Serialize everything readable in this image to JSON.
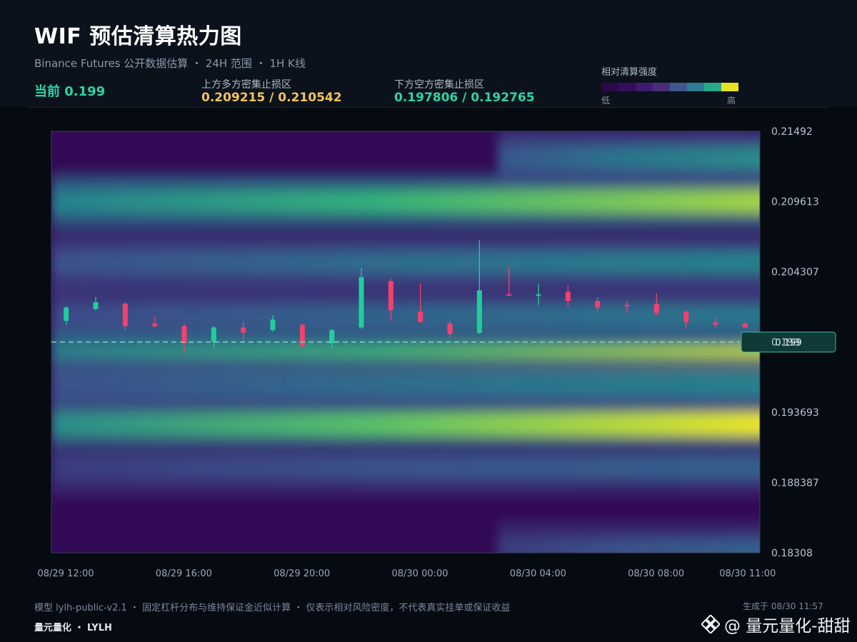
{
  "header": {
    "title": "WIF 预估清算热力图",
    "subtitle": "Binance Futures 公开数据估算 ・ 24H 范围 ・ 1H K线",
    "current_label": "当前 0.199",
    "upper_zone_label": "上方多方密集止损区",
    "upper_zone_value": "0.209215 / 0.210542",
    "lower_zone_label": "下方空方密集止损区",
    "lower_zone_value": "0.197806 / 0.192765"
  },
  "legend": {
    "title": "相对清算强度",
    "low": "低",
    "high": "高",
    "colors": [
      "#2b0a4c",
      "#360d5e",
      "#3f1b6f",
      "#4a2c7c",
      "#41568f",
      "#2f7a94",
      "#27a98a",
      "#e9e221"
    ]
  },
  "colors": {
    "up_candle": "#1fcf9b",
    "down_candle": "#f2416e",
    "current_line": "#7fd7d0",
    "accent_green": "#2fd4a6",
    "accent_gold": "#f5c35c"
  },
  "chart_data": {
    "type": "heatmap",
    "title": "WIF 预估清算热力图",
    "y_ticks": [
      "0.21492",
      "0.209613",
      "0.204307",
      "0.199",
      "0.193693",
      "0.188387",
      "0.18308"
    ],
    "ylim": [
      0.18308,
      0.21492
    ],
    "x_ticks": [
      "08/29 12:00",
      "08/29 16:00",
      "08/29 20:00",
      "08/30 00:00",
      "08/30 04:00",
      "08/30 08:00",
      "08/30 11:00"
    ],
    "current_price": 0.199,
    "current_price_label": "0.199",
    "heat_bands": [
      {
        "price": 0.2096,
        "intensity": 0.9,
        "x_start": 0.0
      },
      {
        "price": 0.2129,
        "intensity": 0.55,
        "x_start": 0.63
      },
      {
        "price": 0.205,
        "intensity": 0.5,
        "x_start": 0.0
      },
      {
        "price": 0.201,
        "intensity": 0.45,
        "x_start": 0.0
      },
      {
        "price": 0.1978,
        "intensity": 0.95,
        "x_start": 0.0
      },
      {
        "price": 0.1928,
        "intensity": 1.0,
        "x_start": 0.0
      },
      {
        "price": 0.1958,
        "intensity": 0.5,
        "x_start": 0.0
      },
      {
        "price": 0.1895,
        "intensity": 0.35,
        "x_start": 0.0
      },
      {
        "price": 0.1833,
        "intensity": 0.35,
        "x_start": 0.63
      }
    ],
    "candles": [
      {
        "o": 0.2006,
        "h": 0.2017,
        "l": 0.2003,
        "c": 0.2016
      },
      {
        "o": 0.2015,
        "h": 0.2024,
        "l": 0.2014,
        "c": 0.202
      },
      {
        "o": 0.2019,
        "h": 0.202,
        "l": 0.1999,
        "c": 0.2002
      },
      {
        "o": 0.2004,
        "h": 0.2009,
        "l": 0.2001,
        "c": 0.2002
      },
      {
        "o": 0.2002,
        "h": 0.2004,
        "l": 0.1982,
        "c": 0.1989
      },
      {
        "o": 0.199,
        "h": 0.2002,
        "l": 0.1986,
        "c": 0.2001
      },
      {
        "o": 0.2001,
        "h": 0.2005,
        "l": 0.199,
        "c": 0.1997
      },
      {
        "o": 0.1999,
        "h": 0.201,
        "l": 0.1998,
        "c": 0.2007
      },
      {
        "o": 0.2003,
        "h": 0.2004,
        "l": 0.1986,
        "c": 0.1987
      },
      {
        "o": 0.1989,
        "h": 0.2,
        "l": 0.1985,
        "c": 0.1999
      },
      {
        "o": 0.2001,
        "h": 0.2046,
        "l": 0.2,
        "c": 0.2039
      },
      {
        "o": 0.2036,
        "h": 0.2038,
        "l": 0.2006,
        "c": 0.2014
      },
      {
        "o": 0.2013,
        "h": 0.2034,
        "l": 0.2005,
        "c": 0.2005
      },
      {
        "o": 0.2004,
        "h": 0.2006,
        "l": 0.1993,
        "c": 0.1996
      },
      {
        "o": 0.1997,
        "h": 0.2067,
        "l": 0.1996,
        "c": 0.2029
      },
      {
        "o": 0.2026,
        "h": 0.2047,
        "l": 0.2025,
        "c": 0.2025
      },
      {
        "o": 0.2025,
        "h": 0.2034,
        "l": 0.2018,
        "c": 0.2026
      },
      {
        "o": 0.2028,
        "h": 0.2033,
        "l": 0.2017,
        "c": 0.2021
      },
      {
        "o": 0.2021,
        "h": 0.2024,
        "l": 0.2013,
        "c": 0.2016
      },
      {
        "o": 0.2018,
        "h": 0.2021,
        "l": 0.2012,
        "c": 0.2017
      },
      {
        "o": 0.2019,
        "h": 0.2027,
        "l": 0.201,
        "c": 0.2012
      },
      {
        "o": 0.2013,
        "h": 0.2014,
        "l": 0.2,
        "c": 0.2005
      },
      {
        "o": 0.2005,
        "h": 0.2009,
        "l": 0.2001,
        "c": 0.2003
      },
      {
        "o": 0.2004,
        "h": 0.2005,
        "l": 0.2,
        "c": 0.2001
      }
    ]
  },
  "footer": {
    "note": "模型 lylh-public-v2.1 ・ 固定杠杆分布与维持保证金近似计算 ・ 仅表示相对风险密度，不代表真实挂单或保证收益",
    "brand": "量元量化 ・ LYLH",
    "generated": "生成于 08/30 11:57",
    "watermark": "@ 量元量化-甜甜"
  }
}
